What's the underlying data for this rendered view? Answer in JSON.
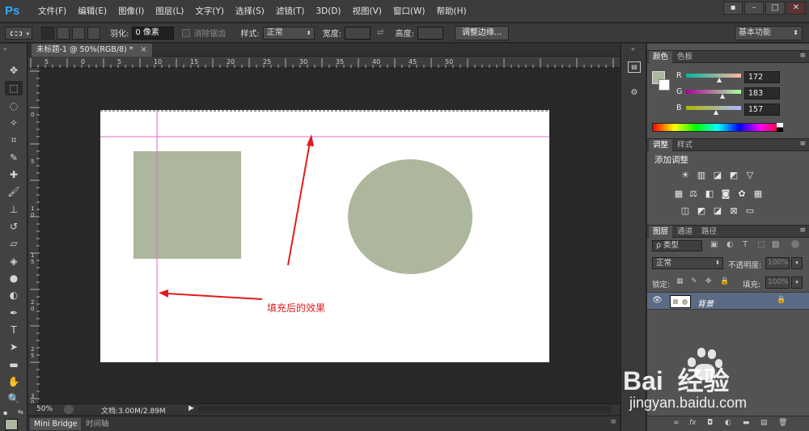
{
  "app": {
    "logo": "Ps"
  },
  "menu": [
    "文件(F)",
    "编辑(E)",
    "图像(I)",
    "图层(L)",
    "文字(Y)",
    "选择(S)",
    "滤镜(T)",
    "3D(D)",
    "视图(V)",
    "窗口(W)",
    "帮助(H)"
  ],
  "window_controls": [
    "▪",
    "–",
    "□",
    "✕"
  ],
  "options": {
    "feather_label": "羽化:",
    "feather_value": "0 像素",
    "antialias_label": "消除锯齿",
    "style_label": "样式:",
    "style_value": "正常",
    "width_label": "宽度:",
    "height_label": "高度:",
    "refine_edge": "调整边缘...",
    "workspace": "基本功能"
  },
  "document": {
    "tab_title": "未标题-1 @ 50%(RGB/8) *",
    "annotation": "填充后的效果",
    "colors": {
      "shape": "#acb79d",
      "guide": "#e56ad3",
      "arrow": "#e31b1b",
      "canvas": "#ffffff"
    }
  },
  "ruler_top_ticks": [
    "5",
    "0",
    "5",
    "10",
    "15",
    "20",
    "25",
    "30",
    "35",
    "40",
    "45",
    "50"
  ],
  "ruler_left_ticks": [
    "0",
    "5",
    "1\n0",
    "1\n5",
    "2\n0",
    "2\n5",
    "3\n0"
  ],
  "status": {
    "zoom": "50%",
    "doc_info": "文档:3.00M/2.89M"
  },
  "bottom_tabs": {
    "mini_bridge": "Mini Bridge",
    "timeline": "时间轴"
  },
  "color_panel": {
    "tabs": [
      "颜色",
      "色板"
    ],
    "r_label": "R",
    "g_label": "G",
    "b_label": "B",
    "r": "172",
    "g": "183",
    "b": "157",
    "foreground": "#acb79d"
  },
  "adjust_panel": {
    "tabs": [
      "调整",
      "样式"
    ],
    "title": "添加调整"
  },
  "layers_panel": {
    "tabs": [
      "图层",
      "通道",
      "路径"
    ],
    "filter_label": "ρ 类型",
    "blend_mode": "正常",
    "opacity_label": "不透明度:",
    "opacity_value": "100%",
    "lock_label": "锁定:",
    "fill_label": "填充:",
    "fill_value": "100%",
    "layer_name": "背景"
  },
  "watermark": {
    "brand": "Bai  经验",
    "url": "jingyan.baidu.com"
  }
}
